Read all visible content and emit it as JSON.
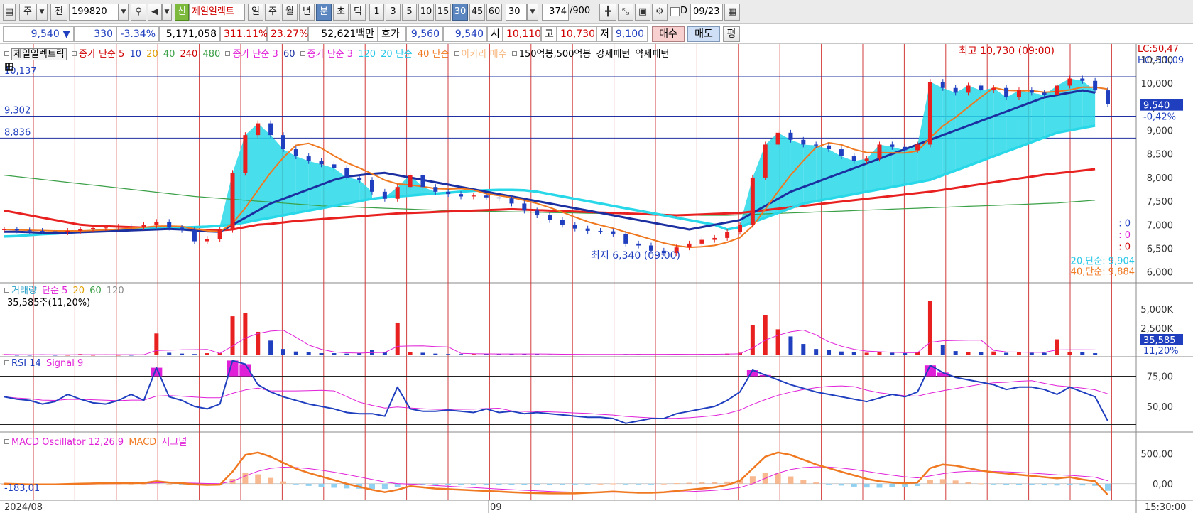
{
  "toolbar": {
    "market": "주",
    "prev_label": "전",
    "stock_code": "199820",
    "new_badge": "신",
    "stock_name": "제일일렉트",
    "periods": [
      "일",
      "주",
      "월",
      "년",
      "분",
      "초",
      "틱"
    ],
    "active_period": "분",
    "minutes": [
      "1",
      "3",
      "5",
      "10",
      "15",
      "30",
      "45",
      "60"
    ],
    "active_minute": "30",
    "minute_select": "30",
    "count": "374",
    "count_total": "/900",
    "date_check_label": "D",
    "date": "09/23"
  },
  "quote": {
    "price": "9,540",
    "direction": "▼",
    "change": "330",
    "change_pct": "-3.34%",
    "volume": "5,171,058",
    "vol_ratio": "311.11%",
    "turnover": "23.27%",
    "amount": "52,621백만",
    "hoga_label": "호가",
    "ask": "9,560",
    "bid": "9,540",
    "open_label": "시",
    "open": "10,110",
    "high_label": "고",
    "high": "10,730",
    "low_label": "저",
    "low": "9,100",
    "buy_btn": "매수",
    "sell_btn": "매도",
    "eval_btn": "평"
  },
  "legend_main": {
    "name": "제일일렉트릭",
    "ma1": "종가 단순 5",
    "ma1_periods": [
      "10",
      "20",
      "40",
      "240",
      "480"
    ],
    "ma2": "종가 단순 3",
    "ma2_periods": [
      "60"
    ],
    "ma3": "종가 단순 3",
    "ma3_periods": [
      "120"
    ],
    "l4": "20 단순",
    "l5": "40 단순",
    "l6": "아카라 매수",
    "l7": "150억봉,500억봉",
    "l8": "강세패턴",
    "l9": "약세패턴"
  },
  "main_panel": {
    "lc": "LC:50,47",
    "hc": "HC:-11,09",
    "ref_lines": [
      "10,137",
      "9,302",
      "8,836"
    ],
    "price_box": "9,540",
    "price_pct": "-0,42%",
    "high_annot": "최고 10,730 (09:00)",
    "low_annot": "최저 6,340 (09:00)",
    "zero_labels": [
      ": 0",
      ": 0",
      ": 0"
    ],
    "ma20_label": "20,단순: 9,904",
    "ma40_label": "40,단순: 9,884"
  },
  "volume_panel": {
    "legend": [
      "거래량",
      "단순 5",
      "20",
      "60",
      "120"
    ],
    "value": "35,585주(11,20%)",
    "axis": [
      "5,000K",
      "2,500K"
    ],
    "box_val": "35,585",
    "box_pct": "11,20%"
  },
  "rsi_panel": {
    "legend": [
      "RSI 14",
      "Signal 9"
    ],
    "axis": [
      "75,00",
      "50,00"
    ]
  },
  "macd_panel": {
    "legend": [
      "MACD Oscillator 12,26,9",
      "MACD",
      "시그널"
    ],
    "value": "-183,01",
    "axis": [
      "500,00",
      "0,00"
    ]
  },
  "xaxis": {
    "left": "2024/08",
    "mid": "09",
    "time": "15:30:00"
  },
  "colors": {
    "candle_up": "#e82020",
    "candle_down": "#1f3fbf",
    "cyan": "#28d8e8",
    "orange": "#f07820",
    "navy": "#1c2fa0",
    "red_ma": "#e82020",
    "green_ma": "#3ca048",
    "magenta": "#e020d8",
    "vgrid": "#d23c3c"
  },
  "chart_data": {
    "type": "line",
    "ylim": [
      5800,
      10800
    ],
    "yticks": [
      6000,
      6500,
      7000,
      7500,
      8000,
      8500,
      9000,
      9500,
      10000,
      10500
    ],
    "price_series": [
      6900,
      6880,
      6870,
      6860,
      6840,
      6870,
      6900,
      6930,
      6940,
      6960,
      6950,
      6990,
      7060,
      6940,
      6890,
      6650,
      6700,
      6890,
      8100,
      8900,
      9150,
      8900,
      8600,
      8450,
      8350,
      8280,
      8200,
      8000,
      7950,
      7700,
      7550,
      7800,
      8050,
      7800,
      7700,
      7650,
      7600,
      7620,
      7580,
      7560,
      7450,
      7300,
      7200,
      7100,
      7000,
      6920,
      6870,
      6860,
      6810,
      6600,
      6560,
      6450,
      6400,
      6520,
      6600,
      6680,
      6720,
      6850,
      7000,
      8000,
      8700,
      8950,
      8800,
      8700,
      8680,
      8600,
      8450,
      8350,
      8400,
      8700,
      8650,
      8580,
      8700,
      10030,
      9900,
      9800,
      9950,
      9850,
      9900,
      9700,
      9850,
      9800,
      9750,
      9950,
      10100,
      10050,
      9850,
      9550
    ],
    "ma_cyan": [
      6750,
      6760,
      6780,
      6800,
      6810,
      6830,
      6850,
      6870,
      6880,
      6890,
      6900,
      6910,
      6920,
      6930,
      6940,
      6950,
      6960,
      6980,
      7000,
      7050,
      7100,
      7150,
      7200,
      7250,
      7300,
      7350,
      7400,
      7450,
      7500,
      7550,
      7580,
      7600,
      7620,
      7640,
      7660,
      7680,
      7700,
      7720,
      7730,
      7740,
      7740,
      7730,
      7700,
      7650,
      7600,
      7550,
      7500,
      7450,
      7400,
      7350,
      7300,
      7250,
      7200,
      7150,
      7100,
      7050,
      7000,
      6900,
      6950,
      7050,
      7150,
      7250,
      7350,
      7450,
      7500,
      7550,
      7600,
      7650,
      7700,
      7750,
      7800,
      7850,
      7900,
      7950,
      8050,
      8150,
      8250,
      8350,
      8450,
      8550,
      8650,
      8750,
      8850,
      8950,
      9000,
      9050,
      9100
    ],
    "ma_navy": [
      6850,
      6850,
      6840,
      6830,
      6830,
      6830,
      6840,
      6850,
      6860,
      6870,
      6880,
      6890,
      6900,
      6910,
      6900,
      6880,
      6860,
      6850,
      7000,
      7150,
      7300,
      7450,
      7550,
      7650,
      7750,
      7850,
      7950,
      8020,
      8050,
      8080,
      8100,
      8050,
      8000,
      7950,
      7900,
      7850,
      7800,
      7750,
      7700,
      7650,
      7600,
      7550,
      7500,
      7450,
      7400,
      7350,
      7300,
      7250,
      7200,
      7150,
      7100,
      7050,
      7000,
      6950,
      6900,
      6950,
      7000,
      7050,
      7100,
      7250,
      7400,
      7550,
      7700,
      7800,
      7900,
      8000,
      8100,
      8200,
      8300,
      8400,
      8500,
      8600,
      8700,
      8800,
      8900,
      9000,
      9100,
      9200,
      9300,
      9400,
      9500,
      9600,
      9700,
      9750,
      9800,
      9850,
      9800
    ],
    "ma_red": [
      7300,
      7250,
      7200,
      7150,
      7100,
      7050,
      7000,
      6980,
      6970,
      6960,
      6950,
      6940,
      6930,
      6920,
      6910,
      6900,
      6890,
      6880,
      6900,
      6950,
      7000,
      7020,
      7050,
      7080,
      7100,
      7120,
      7140,
      7160,
      7180,
      7200,
      7220,
      7240,
      7250,
      7260,
      7270,
      7280,
      7290,
      7300,
      7310,
      7320,
      7330,
      7320,
      7310,
      7300,
      7290,
      7280,
      7270,
      7260,
      7250,
      7240,
      7230,
      7220,
      7210,
      7200,
      7210,
      7220,
      7230,
      7240,
      7250,
      7280,
      7310,
      7340,
      7370,
      7400,
      7430,
      7460,
      7490,
      7520,
      7550,
      7580,
      7610,
      7640,
      7670,
      7700,
      7740,
      7780,
      7820,
      7860,
      7900,
      7940,
      7980,
      8020,
      8060,
      8090,
      8120,
      8150,
      8180
    ],
    "ma_green": [
      8050,
      8020,
      7990,
      7960,
      7930,
      7900,
      7870,
      7840,
      7810,
      7780,
      7750,
      7720,
      7690,
      7660,
      7630,
      7600,
      7580,
      7560,
      7540,
      7520,
      7500,
      7480,
      7460,
      7440,
      7420,
      7400,
      7390,
      7380,
      7370,
      7360,
      7350,
      7340,
      7330,
      7320,
      7310,
      7300,
      7295,
      7290,
      7285,
      7280,
      7275,
      7270,
      7265,
      7260,
      7255,
      7250,
      7245,
      7240,
      7235,
      7230,
      7225,
      7220,
      7215,
      7210,
      7205,
      7200,
      7200,
      7200,
      7210,
      7220,
      7230,
      7240,
      7250,
      7260,
      7270,
      7280,
      7290,
      7300,
      7310,
      7320,
      7330,
      7340,
      7350,
      7360,
      7370,
      7380,
      7390,
      7400,
      7410,
      7420,
      7430,
      7440,
      7450,
      7460,
      7480,
      7500,
      7520
    ],
    "volume": [
      0.02,
      0.01,
      0.01,
      0.02,
      0.01,
      0.01,
      0.03,
      0.01,
      0.02,
      0.01,
      0.01,
      0.02,
      0.52,
      0.06,
      0.04,
      0.03,
      0.05,
      0.05,
      0.93,
      1.0,
      0.56,
      0.35,
      0.15,
      0.09,
      0.07,
      0.05,
      0.05,
      0.04,
      0.05,
      0.12,
      0.08,
      0.78,
      0.08,
      0.06,
      0.04,
      0.03,
      0.03,
      0.03,
      0.04,
      0.03,
      0.03,
      0.03,
      0.03,
      0.02,
      0.02,
      0.02,
      0.02,
      0.02,
      0.02,
      0.03,
      0.03,
      0.02,
      0.02,
      0.03,
      0.02,
      0.03,
      0.03,
      0.04,
      0.06,
      0.72,
      0.95,
      0.62,
      0.45,
      0.27,
      0.15,
      0.12,
      0.09,
      0.08,
      0.06,
      0.07,
      0.06,
      0.05,
      0.07,
      1.3,
      0.25,
      0.1,
      0.08,
      0.07,
      0.09,
      0.06,
      0.08,
      0.06,
      0.06,
      0.38,
      0.08,
      0.07,
      0.05
    ],
    "rsi": [
      58,
      56,
      55,
      52,
      54,
      60,
      56,
      53,
      52,
      55,
      60,
      55,
      82,
      58,
      55,
      50,
      48,
      52,
      88,
      85,
      68,
      62,
      58,
      55,
      52,
      50,
      48,
      45,
      44,
      44,
      42,
      66,
      48,
      46,
      46,
      47,
      46,
      45,
      48,
      45,
      46,
      44,
      45,
      44,
      43,
      42,
      41,
      41,
      40,
      36,
      38,
      40,
      40,
      44,
      46,
      48,
      50,
      55,
      62,
      80,
      76,
      72,
      68,
      65,
      62,
      60,
      58,
      56,
      54,
      57,
      60,
      58,
      62,
      84,
      78,
      74,
      72,
      70,
      68,
      64,
      66,
      66,
      64,
      60,
      66,
      62,
      58,
      38
    ],
    "macd": [
      0,
      -5,
      -10,
      -12,
      -10,
      -5,
      0,
      5,
      8,
      10,
      10,
      12,
      40,
      20,
      10,
      -10,
      -20,
      -15,
      200,
      480,
      520,
      450,
      350,
      250,
      180,
      120,
      60,
      0,
      -50,
      -100,
      -140,
      -100,
      -40,
      -60,
      -80,
      -90,
      -100,
      -110,
      -120,
      -130,
      -140,
      -150,
      -155,
      -160,
      -160,
      -160,
      -150,
      -140,
      -130,
      -140,
      -150,
      -150,
      -140,
      -120,
      -100,
      -80,
      -60,
      -20,
      50,
      250,
      450,
      520,
      480,
      400,
      320,
      260,
      200,
      140,
      80,
      40,
      20,
      10,
      20,
      260,
      320,
      300,
      260,
      220,
      190,
      170,
      150,
      130,
      110,
      90,
      110,
      70,
      40,
      -183
    ],
    "macd_signal": [
      0,
      -3,
      -6,
      -8,
      -9,
      -8,
      -6,
      -3,
      0,
      3,
      6,
      8,
      15,
      17,
      15,
      10,
      4,
      0,
      40,
      130,
      208,
      256,
      275,
      270,
      252,
      226,
      193,
      155,
      114,
      71,
      29,
      3,
      -6,
      -17,
      -30,
      -42,
      -54,
      -65,
      -76,
      -87,
      -98,
      -108,
      -118,
      -127,
      -134,
      -139,
      -141,
      -141,
      -139,
      -139,
      -141,
      -143,
      -143,
      -138,
      -131,
      -121,
      -109,
      -91,
      -63,
      0,
      90,
      176,
      237,
      270,
      280,
      276,
      261,
      237,
      206,
      173,
      142,
      116,
      97,
      130,
      168,
      194,
      207,
      209,
      205,
      198,
      188,
      176,
      163,
      148,
      140,
      126,
      109,
      50
    ]
  }
}
